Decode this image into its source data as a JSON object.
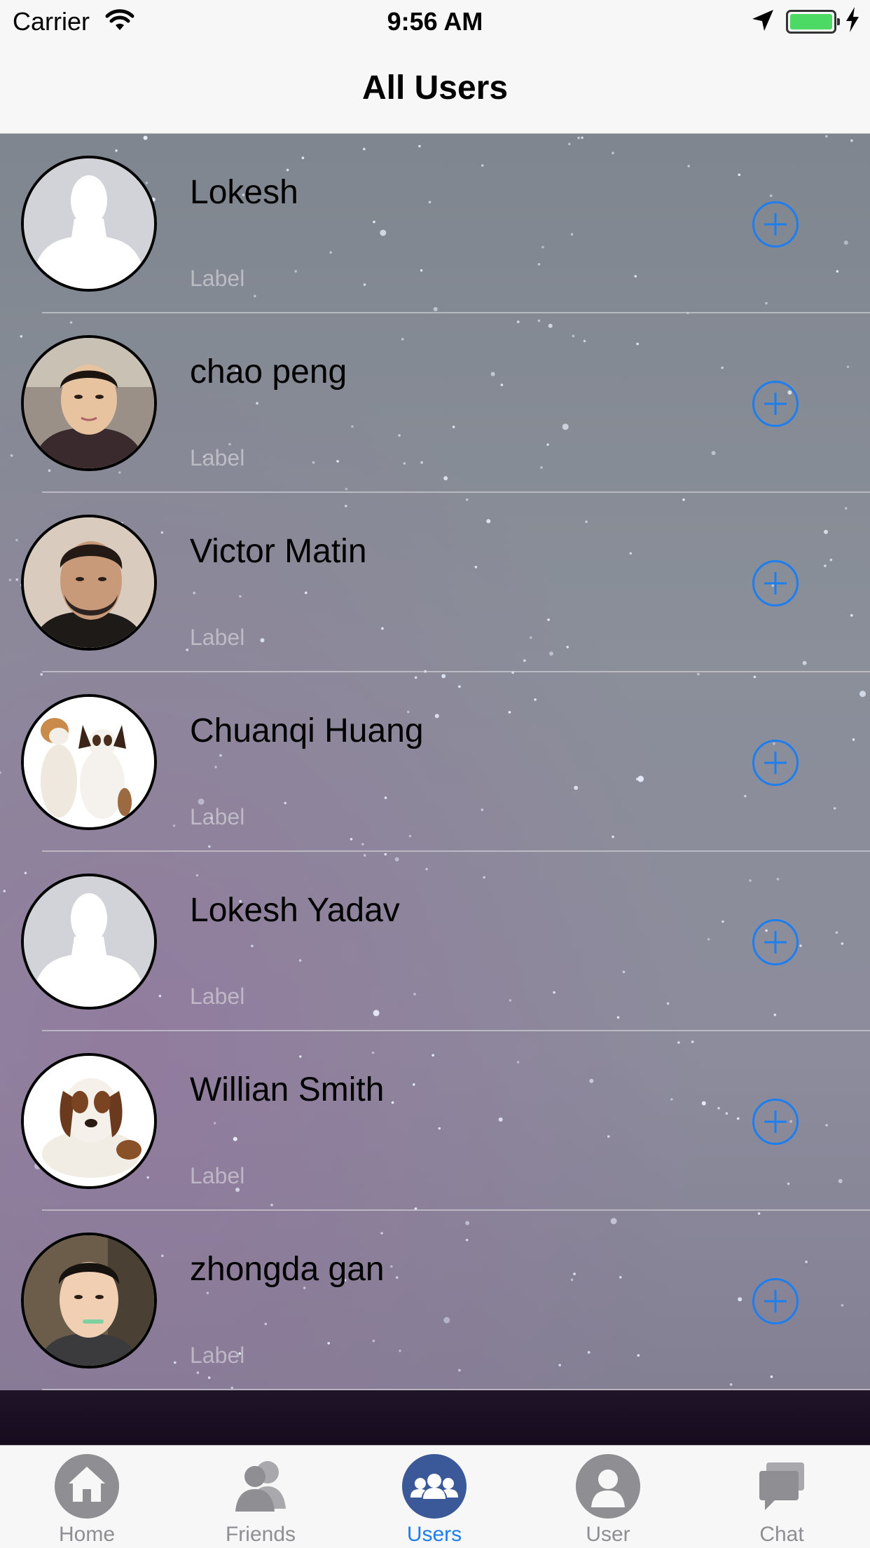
{
  "status_bar": {
    "carrier": "Carrier",
    "time": "9:56 AM",
    "icons": [
      "wifi-icon",
      "location-arrow-icon",
      "battery-icon",
      "charging-bolt-icon"
    ],
    "battery_color": "#4cd964"
  },
  "nav": {
    "title": "All Users"
  },
  "users": [
    {
      "name": "Lokesh",
      "subtitle": "Label",
      "avatar": "default-silhouette"
    },
    {
      "name": "chao peng",
      "subtitle": "Label",
      "avatar": "photo"
    },
    {
      "name": "Victor Matin",
      "subtitle": "Label",
      "avatar": "photo"
    },
    {
      "name": "Chuanqi Huang",
      "subtitle": "Label",
      "avatar": "dogs-photo"
    },
    {
      "name": "Lokesh Yadav",
      "subtitle": "Label",
      "avatar": "default-silhouette"
    },
    {
      "name": "Willian Smith",
      "subtitle": "Label",
      "avatar": "dog-photo"
    },
    {
      "name": "zhongda gan",
      "subtitle": "Label",
      "avatar": "photo"
    }
  ],
  "tabs": [
    {
      "label": "Home",
      "icon": "home-icon",
      "selected": false
    },
    {
      "label": "Friends",
      "icon": "friends-icon",
      "selected": false
    },
    {
      "label": "Users",
      "icon": "users-icon",
      "selected": true
    },
    {
      "label": "User",
      "icon": "user-icon",
      "selected": false
    },
    {
      "label": "Chat",
      "icon": "chat-icon",
      "selected": false
    }
  ],
  "colors": {
    "accent": "#1d7ef0",
    "inactive_tab": "#8e8e93",
    "bar_background": "#f7f7f7"
  }
}
